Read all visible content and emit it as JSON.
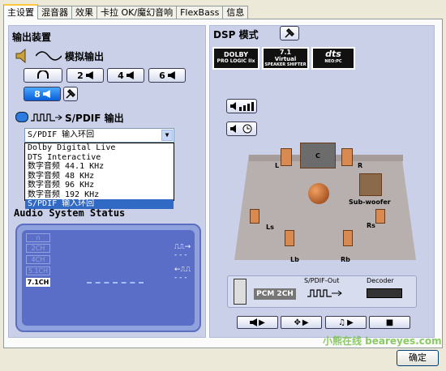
{
  "tabs": [
    "主设置",
    "混音器",
    "效果",
    "卡拉 OK/魔幻音响",
    "FlexBass",
    "信息"
  ],
  "output": {
    "header": "输出装置",
    "analog_label": "模拟输出",
    "buttons": [
      "2",
      "4",
      "6",
      "8"
    ],
    "spdif_label": "S/PDIF 输出",
    "select_value": "S/PDIF 输入环回",
    "options": [
      "Dolby Digital Live",
      "DTS Interactive",
      "数字音频 44.1 KHz",
      "数字音频 48 KHz",
      "数字音频 96 KHz",
      "数字音频 192 KHz",
      "S/PDIF 输入环回"
    ]
  },
  "status": {
    "header": "Audio System Status",
    "channels": [
      "2CH",
      "4CH",
      "5.1CH",
      "7.1CH"
    ],
    "active": "7.1CH"
  },
  "dsp": {
    "header": "DSP 模式",
    "logos": [
      {
        "top": "DOLBY",
        "bottom": "PRO LOGIC IIx"
      },
      {
        "top": "7.1",
        "mid": "Virtual",
        "bottom": "SPEAKER SHIFTER"
      },
      {
        "top": "dts",
        "bottom": "NEO:PC"
      }
    ],
    "speakers": {
      "c": "C",
      "l": "L",
      "r": "R",
      "sub": "Sub-woofer",
      "ls": "Ls",
      "rs": "Rs",
      "lb": "Lb",
      "rb": "Rb"
    },
    "flow": {
      "format": "PCM 2CH",
      "spdif_out": "S/PDIF-Out",
      "decoder": "Decoder"
    }
  },
  "ok_label": "确定",
  "watermark": "小熊在线 beareyes.com"
}
